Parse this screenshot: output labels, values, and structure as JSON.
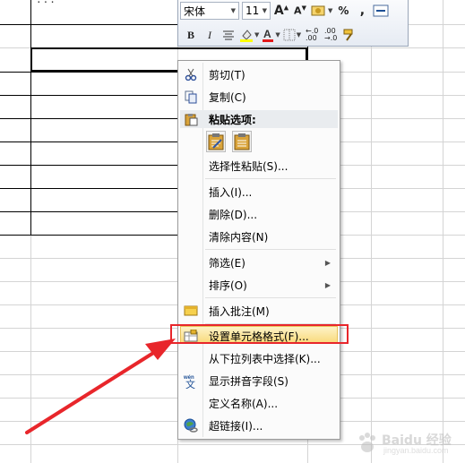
{
  "sheet": {
    "partial_text": "..."
  },
  "mini_toolbar": {
    "font_name": "宋体",
    "font_size": "11",
    "percent": "%",
    "comma": ","
  },
  "context_menu": {
    "items": [
      {
        "label": "剪切(T)"
      },
      {
        "label": "复制(C)"
      },
      {
        "label": "选择性粘贴(S)..."
      },
      {
        "label": "插入(I)..."
      },
      {
        "label": "删除(D)..."
      },
      {
        "label": "清除内容(N)"
      },
      {
        "label": "筛选(E)"
      },
      {
        "label": "排序(O)"
      },
      {
        "label": "插入批注(M)"
      },
      {
        "label": "设置单元格格式(F)..."
      },
      {
        "label": "从下拉列表中选择(K)..."
      },
      {
        "label": "显示拼音字段(S)"
      },
      {
        "label": "定义名称(A)..."
      },
      {
        "label": "超链接(I)..."
      }
    ],
    "paste_header": "粘贴选项:"
  },
  "watermark": {
    "brand": "Baidu 经验",
    "url": "jingyan.baidu.com"
  },
  "colors": {
    "highlight": "#f9d97a",
    "annotation": "#e8262b"
  }
}
